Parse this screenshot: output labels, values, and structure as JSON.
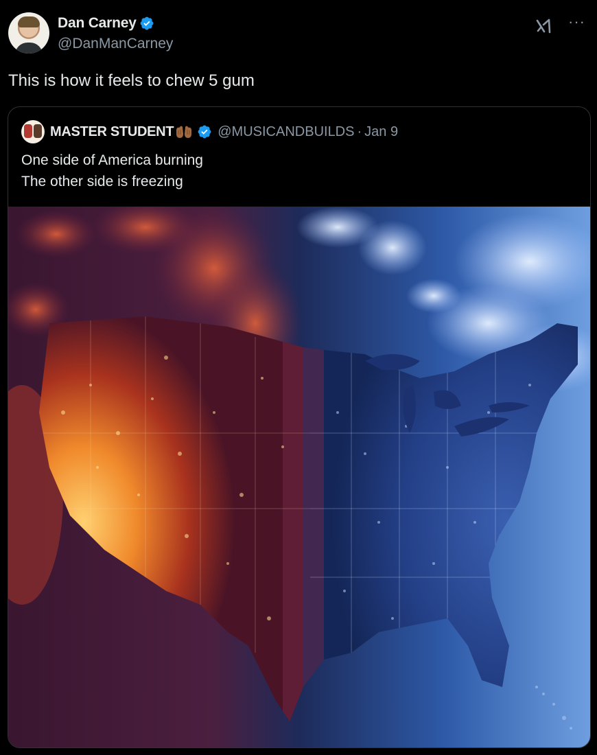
{
  "tweet": {
    "author": {
      "display_name": "Dan Carney",
      "handle": "@DanManCarney",
      "verified": true
    },
    "text": "This is how it feels to chew 5 gum",
    "actions": {
      "grok_icon": "grok-icon",
      "more_icon": "more-icon",
      "more_label": "···"
    }
  },
  "quoted_tweet": {
    "author": {
      "display_name": "MASTER STUDENT",
      "handle": "@MUSICANDBUILDS",
      "verified": true
    },
    "separator": "·",
    "date": "Jan 9",
    "text_line_1": "One side of America burning",
    "text_line_2": "The other side is freezing",
    "media": {
      "type": "image"
    }
  },
  "colors": {
    "background": "#000000",
    "text_primary": "#e7e9ea",
    "text_secondary": "#8b98a5",
    "verified_blue": "#1d9bf0",
    "border": "#2f3336"
  }
}
